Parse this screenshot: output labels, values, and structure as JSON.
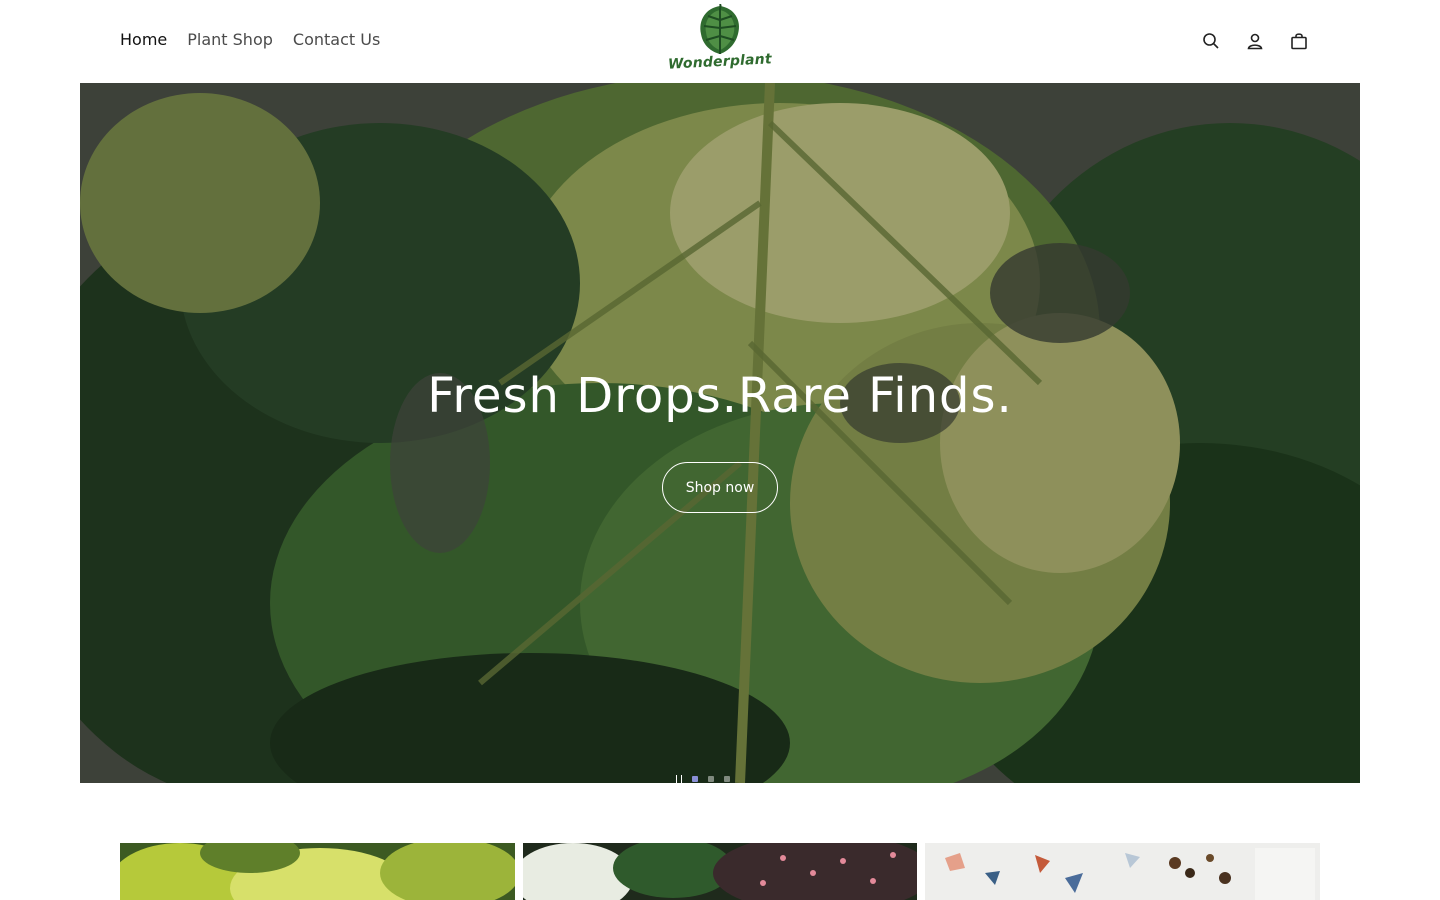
{
  "header": {
    "nav": [
      {
        "label": "Home",
        "active": true
      },
      {
        "label": "Plant Shop",
        "active": false
      },
      {
        "label": "Contact Us",
        "active": false
      }
    ],
    "logo_text": "Wonderplant",
    "icons": [
      "search-icon",
      "account-icon",
      "cart-icon"
    ]
  },
  "hero": {
    "title": "Fresh Drops.Rare Finds.",
    "button_label": "Shop now",
    "slide_count": 3,
    "active_slide": 1
  },
  "tiles": [
    {
      "name": "pothos-tile"
    },
    {
      "name": "variegated-tile"
    },
    {
      "name": "soil-mix-tile"
    }
  ],
  "colors": {
    "brand_green": "#2f6b2f",
    "active_dot": "#8a8fd6",
    "text": "#1f1f1f"
  }
}
